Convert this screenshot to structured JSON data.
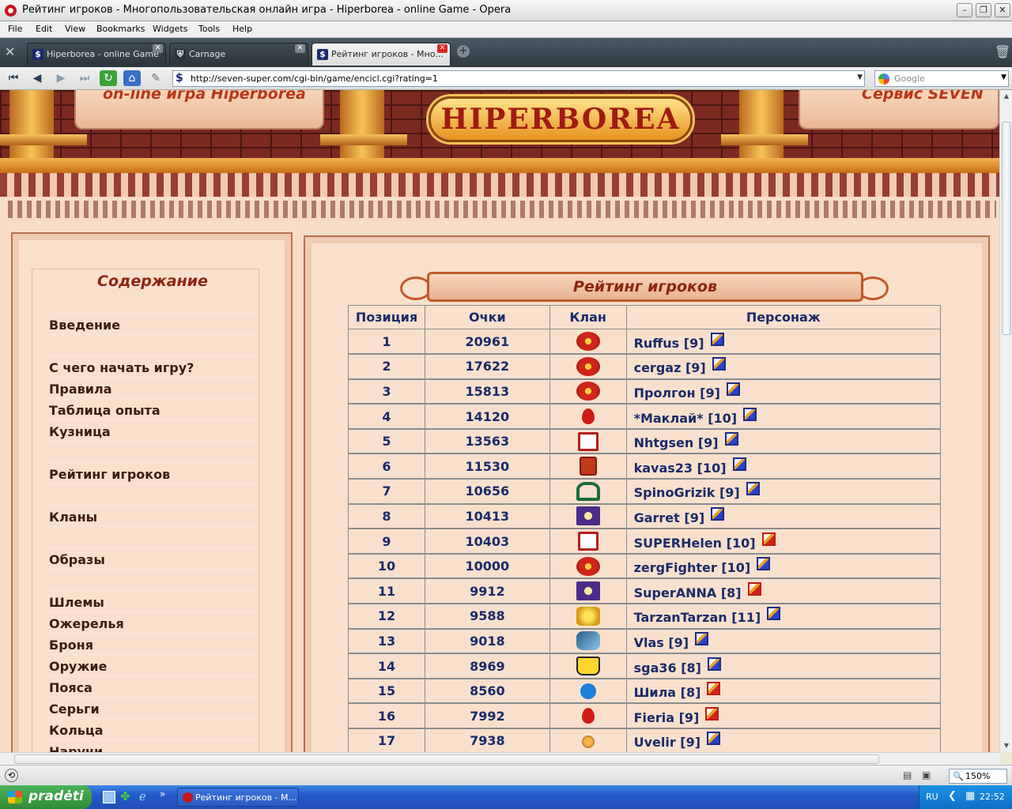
{
  "window": {
    "title": "Рейтинг игроков - Многопользовательская онлайн игра - Hiperborea - online Game - Opera"
  },
  "menu": [
    "File",
    "Edit",
    "View",
    "Bookmarks",
    "Widgets",
    "Tools",
    "Help"
  ],
  "tabs": [
    {
      "label": "Hiperborea - online Game",
      "active": false
    },
    {
      "label": "Carnage",
      "active": false
    },
    {
      "label": "Рейтинг игроков - Мно...",
      "active": true
    }
  ],
  "address": {
    "url": "http://seven-super.com/cgi-bin/game/encicl.cgi?rating=1",
    "search_placeholder": "Google"
  },
  "banner": {
    "left_text": "on-line игра Hiperborea",
    "logo_text": "HIPERBOREA",
    "right_text": "Сервис SEVEN"
  },
  "toc": {
    "title": "Содержание",
    "items": [
      "",
      "Введение",
      "",
      "С чего начать игру?",
      "Правила",
      "Таблица опыта",
      "Кузница",
      "",
      "Рейтинг игроков",
      "",
      "Кланы",
      "",
      "Образы",
      "",
      "Шлемы",
      "Ожерелья",
      "Броня",
      "Оружие",
      "Пояса",
      "Серьги",
      "Кольца",
      "Наручи"
    ]
  },
  "rating": {
    "title": "Рейтинг игроков",
    "headers": [
      "Позиция",
      "Очки",
      "Клан",
      "Персонаж"
    ],
    "rows": [
      {
        "pos": "1",
        "score": "20961",
        "clan": "clan-a",
        "name": "Ruffus [9]",
        "info": "blue"
      },
      {
        "pos": "2",
        "score": "17622",
        "clan": "clan-a",
        "name": "cergaz [9]",
        "info": "blue"
      },
      {
        "pos": "3",
        "score": "15813",
        "clan": "clan-a",
        "name": "Пролгон [9]",
        "info": "blue"
      },
      {
        "pos": "4",
        "score": "14120",
        "clan": "clan-b",
        "name": "*Маклай* [10]",
        "info": "blue"
      },
      {
        "pos": "5",
        "score": "13563",
        "clan": "clan-c",
        "name": "Nhtgsen [9]",
        "info": "blue"
      },
      {
        "pos": "6",
        "score": "11530",
        "clan": "clan-d",
        "name": "kavas23 [10]",
        "info": "blue"
      },
      {
        "pos": "7",
        "score": "10656",
        "clan": "clan-e",
        "name": "SpinoGrizik [9]",
        "info": "blue"
      },
      {
        "pos": "8",
        "score": "10413",
        "clan": "clan-f",
        "name": "Garret [9]",
        "info": "blue"
      },
      {
        "pos": "9",
        "score": "10403",
        "clan": "clan-c",
        "name": "SUPERHelen [10]",
        "info": "red"
      },
      {
        "pos": "10",
        "score": "10000",
        "clan": "clan-a",
        "name": "zergFighter [10]",
        "info": "blue"
      },
      {
        "pos": "11",
        "score": "9912",
        "clan": "clan-f",
        "name": "SuperANNA [8]",
        "info": "red"
      },
      {
        "pos": "12",
        "score": "9588",
        "clan": "clan-g",
        "name": "TarzanTarzan [11]",
        "info": "blue"
      },
      {
        "pos": "13",
        "score": "9018",
        "clan": "clan-h",
        "name": "Vlas [9]",
        "info": "blue"
      },
      {
        "pos": "14",
        "score": "8969",
        "clan": "clan-i",
        "name": "sga36 [8]",
        "info": "blue"
      },
      {
        "pos": "15",
        "score": "8560",
        "clan": "clan-j",
        "name": "Шила [8]",
        "info": "red"
      },
      {
        "pos": "16",
        "score": "7992",
        "clan": "clan-b",
        "name": "Fieria [9]",
        "info": "red"
      },
      {
        "pos": "17",
        "score": "7938",
        "clan": "clan-k",
        "name": "Uvelir [9]",
        "info": "blue"
      }
    ]
  },
  "status": {
    "zoom": "150%"
  },
  "taskbar": {
    "start_label": "pradėti",
    "task_label": "Рейтинг игроков - М...",
    "lang": "RU",
    "clock": "22:52"
  }
}
